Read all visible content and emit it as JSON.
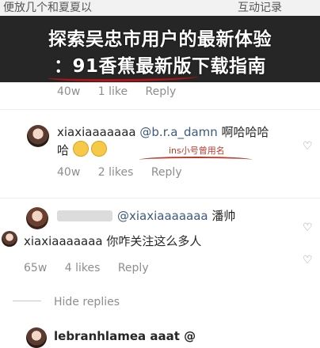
{
  "banner": {
    "peek_left": "便放几个和夏夏以",
    "peek_right": "互动记录",
    "line1": "探索吴忠市用户的最新体验",
    "line2": "：91香蕉最新版下载指南"
  },
  "comment1_meta": {
    "age": "40w",
    "likes": "1 like",
    "reply": "Reply"
  },
  "comment2": {
    "username": "xiaxiaaaaaaa",
    "mention": "@b.r.a_damn",
    "text_after": " 啊哈哈哈",
    "line2": "哈",
    "annotation": "ins小号曾用名",
    "age": "40w",
    "likes": "2 likes",
    "reply": "Reply"
  },
  "comment3": {
    "mention": "@xiaxiaaaaaaa",
    "text": " 潘帅"
  },
  "comment4": {
    "username": "xiaxiaaaaaaa",
    "text": " 你咋关注这么多人",
    "age": "65w",
    "likes": "4 likes",
    "reply": "Reply"
  },
  "hide_replies": "Hide replies",
  "comment5": {
    "partial": "lebranhlamea  aaat @"
  }
}
